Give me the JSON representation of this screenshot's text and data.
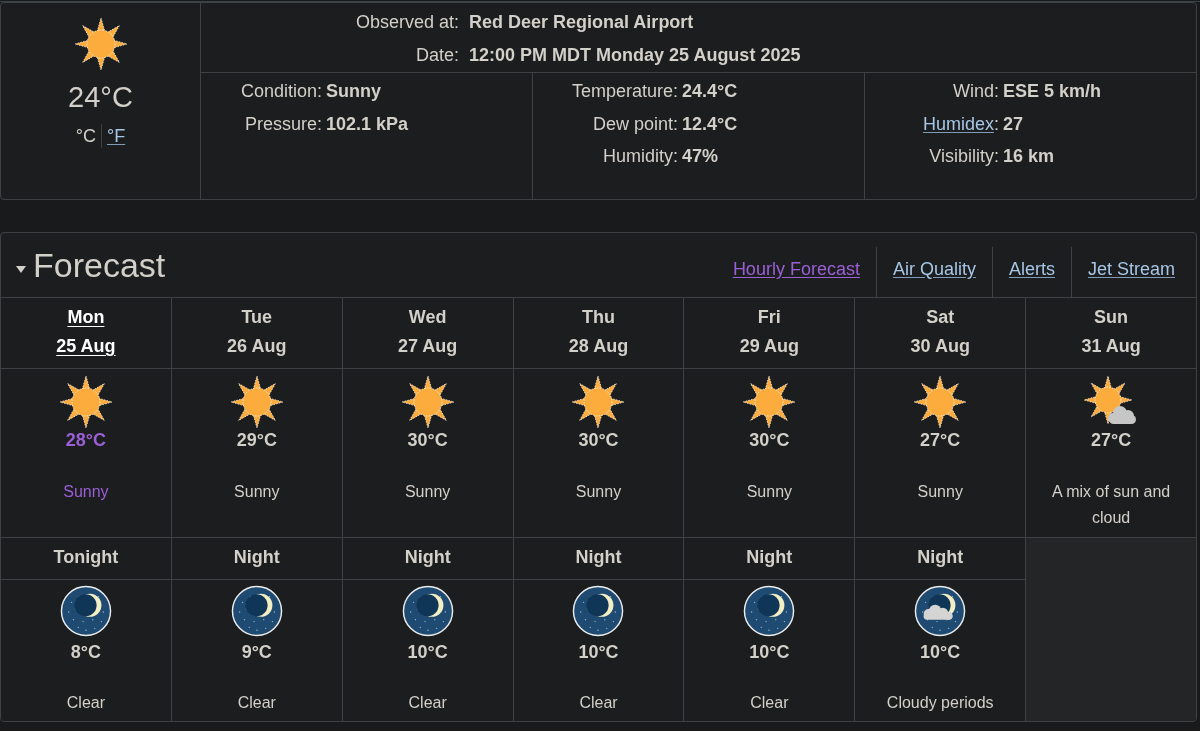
{
  "current": {
    "kind": "sun",
    "temperature": "24°C",
    "units": [
      {
        "label": "°C",
        "selected": true
      },
      {
        "label": "°F",
        "selected": false
      }
    ]
  },
  "observation": [
    {
      "label": "Observed at:",
      "value": "Red Deer Regional Airport"
    },
    {
      "label": "Date:",
      "value": "12:00 PM MDT Monday 25 August 2025"
    }
  ],
  "conditions": {
    "columns": [
      {
        "rows": [
          {
            "label": "Condition:",
            "value": "Sunny"
          },
          {
            "label": "Pressure:",
            "value": "102.1 kPa"
          }
        ]
      },
      {
        "rows": [
          {
            "label": "Temperature:",
            "value": "24.4°C"
          },
          {
            "label": "Dew point:",
            "value": "12.4°C"
          },
          {
            "label": "Humidity:",
            "value": "47%"
          }
        ]
      },
      {
        "rows": [
          {
            "label": "Wind:",
            "value": "ESE 5 km/h"
          },
          {
            "link": "Humidex",
            "label": ":",
            "value": "27"
          },
          {
            "label": "Visibility:",
            "value": "16 km"
          }
        ]
      }
    ]
  },
  "forecast": {
    "title": "Forecast",
    "expanded": true,
    "links": [
      {
        "label": "Hourly Forecast",
        "visited": true
      },
      {
        "label": "Air Quality",
        "visited": false
      },
      {
        "label": "Alerts",
        "visited": false
      },
      {
        "label": "Jet Stream",
        "visited": false
      }
    ],
    "days": [
      {
        "day": "Mon",
        "date": "25 Aug",
        "selected": true,
        "kind": "sun",
        "temperature": "28°C",
        "condition": "Sunny",
        "night": {
          "label": "Tonight",
          "kind": "moon",
          "temperature": "8°C",
          "condition": "Clear"
        }
      },
      {
        "day": "Tue",
        "date": "26 Aug",
        "selected": false,
        "kind": "sun",
        "temperature": "29°C",
        "condition": "Sunny",
        "night": {
          "label": "Night",
          "kind": "moon",
          "temperature": "9°C",
          "condition": "Clear"
        }
      },
      {
        "day": "Wed",
        "date": "27 Aug",
        "selected": false,
        "kind": "sun",
        "temperature": "30°C",
        "condition": "Sunny",
        "night": {
          "label": "Night",
          "kind": "moon",
          "temperature": "10°C",
          "condition": "Clear"
        }
      },
      {
        "day": "Thu",
        "date": "28 Aug",
        "selected": false,
        "kind": "sun",
        "temperature": "30°C",
        "condition": "Sunny",
        "night": {
          "label": "Night",
          "kind": "moon",
          "temperature": "10°C",
          "condition": "Clear"
        }
      },
      {
        "day": "Fri",
        "date": "29 Aug",
        "selected": false,
        "kind": "sun",
        "temperature": "30°C",
        "condition": "Sunny",
        "night": {
          "label": "Night",
          "kind": "moon",
          "temperature": "10°C",
          "condition": "Clear"
        }
      },
      {
        "day": "Sat",
        "date": "30 Aug",
        "selected": false,
        "kind": "sun",
        "temperature": "27°C",
        "condition": "Sunny",
        "night": {
          "label": "Night",
          "kind": "mooncloud",
          "temperature": "10°C",
          "condition": "Cloudy periods"
        }
      },
      {
        "day": "Sun",
        "date": "31 Aug",
        "selected": false,
        "kind": "suncloud",
        "temperature": "27°C",
        "condition": "A mix of sun and cloud"
      }
    ]
  }
}
